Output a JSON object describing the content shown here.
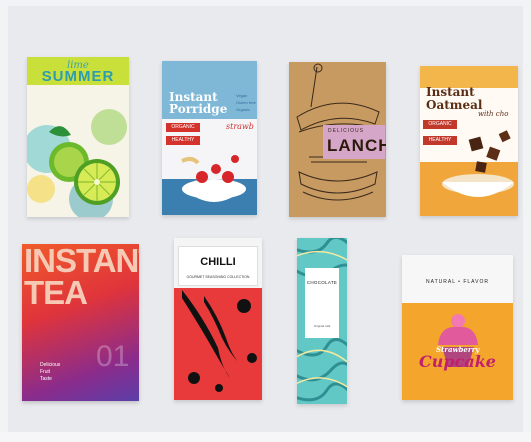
{
  "products": [
    {
      "id": "lime-summer",
      "title_small": "lime",
      "title_big": "SUMMER"
    },
    {
      "id": "porridge",
      "title": "Instant\nPorridge",
      "checklist": [
        "Vegan",
        "Gluten free",
        "Organic"
      ],
      "flavor": "strawb",
      "ribbon1": "ORGANIC",
      "ribbon2": "HEALTHY"
    },
    {
      "id": "lanch",
      "kicker": "DELICIOUS",
      "title": "LANCH"
    },
    {
      "id": "oatmeal",
      "title": "Instant\nOatmeal",
      "subtitle": "with cho",
      "ribbon1": "ORGANIC",
      "ribbon2": "HEALTHY"
    },
    {
      "id": "instant-tea",
      "title_line1": "INSTANT",
      "title_line2": "TEA",
      "tagline": "Delicious\nFruit\nTaste",
      "number": "01"
    },
    {
      "id": "chilli",
      "title": "CHILLI",
      "subtitle": "GOURMET SEASONING COLLECTION"
    },
    {
      "id": "chocolate",
      "title": "CHOCOLATE",
      "note": "Original milk"
    },
    {
      "id": "natural-flavor",
      "brand": "NATURAL • FLAVOR",
      "flavor": "Strawberry",
      "name": "Cupcake"
    }
  ],
  "colors": {
    "background": "#f2f3f5",
    "panel": "#e9eaee",
    "lime": "#c6dd2f",
    "orange": "#f4a32a",
    "teal": "#5cc9c8",
    "red": "#e3302f"
  }
}
